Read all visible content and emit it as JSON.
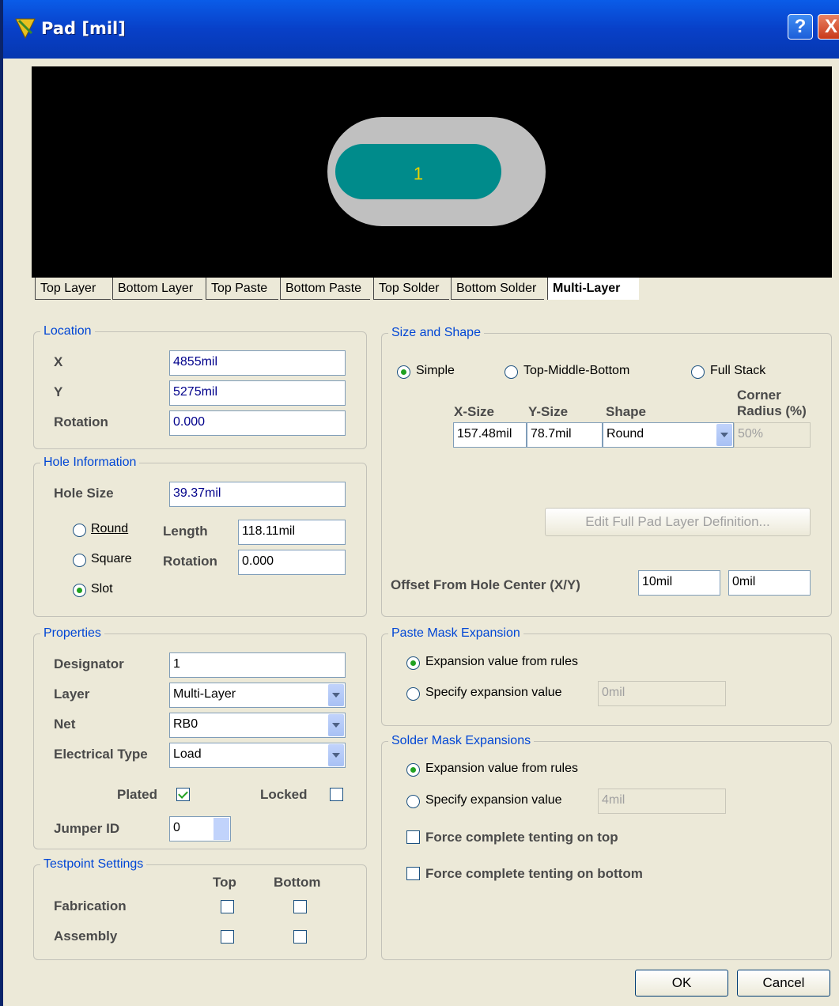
{
  "window": {
    "title": "Pad [mil]",
    "help": "?",
    "close": "X"
  },
  "preview": {
    "pad_label": "1"
  },
  "tabs": [
    "Top Layer",
    "Bottom Layer",
    "Top Paste",
    "Bottom Paste",
    "Top Solder",
    "Bottom Solder",
    "Multi-Layer"
  ],
  "location": {
    "legend": "Location",
    "x_label": "X",
    "x_value": "4855mil",
    "y_label": "Y",
    "y_value": "5275mil",
    "rotation_label": "Rotation",
    "rotation_value": "0.000"
  },
  "hole": {
    "legend": "Hole Information",
    "size_label": "Hole Size",
    "size_value": "39.37mil",
    "round": "Round",
    "square": "Square",
    "slot": "Slot",
    "length_label": "Length",
    "length_value": "118.11mil",
    "rotation_label": "Rotation",
    "rotation_value": "0.000"
  },
  "properties": {
    "legend": "Properties",
    "designator_label": "Designator",
    "designator_value": "1",
    "layer_label": "Layer",
    "layer_value": "Multi-Layer",
    "net_label": "Net",
    "net_value": "RB0",
    "etype_label": "Electrical Type",
    "etype_value": "Load",
    "plated_label": "Plated",
    "locked_label": "Locked",
    "jumper_label": "Jumper ID",
    "jumper_value": "0"
  },
  "testpoint": {
    "legend": "Testpoint Settings",
    "top": "Top",
    "bottom": "Bottom",
    "fabrication": "Fabrication",
    "assembly": "Assembly"
  },
  "size_shape": {
    "legend": "Size and Shape",
    "simple": "Simple",
    "tmb": "Top-Middle-Bottom",
    "full": "Full Stack",
    "xsize_h": "X-Size",
    "ysize_h": "Y-Size",
    "shape_h": "Shape",
    "corner_h1": "Corner",
    "corner_h2": "Radius (%)",
    "xsize": "157.48mil",
    "ysize": "78.7mil",
    "shape": "Round",
    "corner": "50%",
    "edit_btn": "Edit Full Pad Layer Definition...",
    "offset_label": "Offset From Hole Center (X/Y)",
    "offset_x": "10mil",
    "offset_y": "0mil"
  },
  "paste": {
    "legend": "Paste Mask Expansion",
    "rules": "Expansion value from rules",
    "specify": "Specify expansion value",
    "value": "0mil"
  },
  "solder": {
    "legend": "Solder Mask Expansions",
    "rules": "Expansion value from rules",
    "specify": "Specify expansion value",
    "value": "4mil",
    "tent_top": "Force complete tenting on top",
    "tent_bottom": "Force complete tenting on bottom"
  },
  "buttons": {
    "ok": "OK",
    "cancel": "Cancel"
  },
  "colors": {
    "pad": "#008b8b",
    "pad_outer": "#c0c0c0",
    "titlebar": "#0840c8"
  }
}
